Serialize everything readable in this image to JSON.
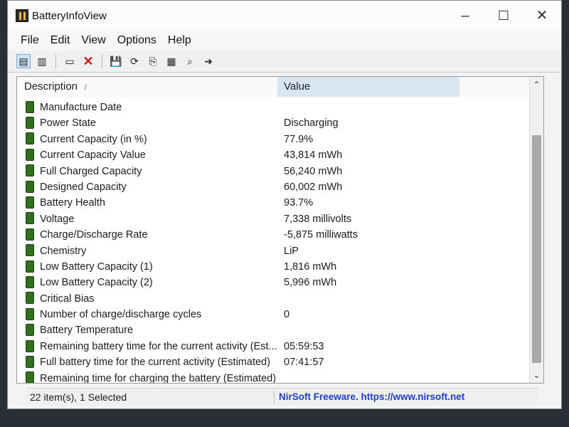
{
  "window": {
    "title": "BatteryInfoView"
  },
  "menu": [
    "File",
    "Edit",
    "View",
    "Options",
    "Help"
  ],
  "list": {
    "headers": {
      "description": "Description",
      "value": "Value"
    },
    "rows": [
      {
        "desc": "Manufacture Date",
        "value": ""
      },
      {
        "desc": "Power State",
        "value": "Discharging"
      },
      {
        "desc": "Current Capacity (in %)",
        "value": "77.9%"
      },
      {
        "desc": "Current Capacity Value",
        "value": "43,814 mWh"
      },
      {
        "desc": "Full Charged Capacity",
        "value": "56,240 mWh"
      },
      {
        "desc": "Designed Capacity",
        "value": "60,002 mWh"
      },
      {
        "desc": "Battery Health",
        "value": "93.7%"
      },
      {
        "desc": "Voltage",
        "value": "7,338 millivolts"
      },
      {
        "desc": "Charge/Discharge Rate",
        "value": "-5,875 milliwatts"
      },
      {
        "desc": "Chemistry",
        "value": "LiP"
      },
      {
        "desc": "Low Battery Capacity (1)",
        "value": "1,816 mWh"
      },
      {
        "desc": "Low Battery Capacity (2)",
        "value": "5,996 mWh"
      },
      {
        "desc": "Critical Bias",
        "value": ""
      },
      {
        "desc": "Number of charge/discharge cycles",
        "value": "0"
      },
      {
        "desc": "Battery Temperature",
        "value": ""
      },
      {
        "desc": "Remaining battery time for the current activity (Est...",
        "value": "05:59:53"
      },
      {
        "desc": "Full battery time for the current activity (Estimated)",
        "value": "07:41:57"
      },
      {
        "desc": "Remaining time for charging the battery (Estimated)",
        "value": ""
      }
    ]
  },
  "status": {
    "items": "22 item(s), 1 Selected",
    "credit": "NirSoft Freeware. https://www.nirsoft.net"
  }
}
